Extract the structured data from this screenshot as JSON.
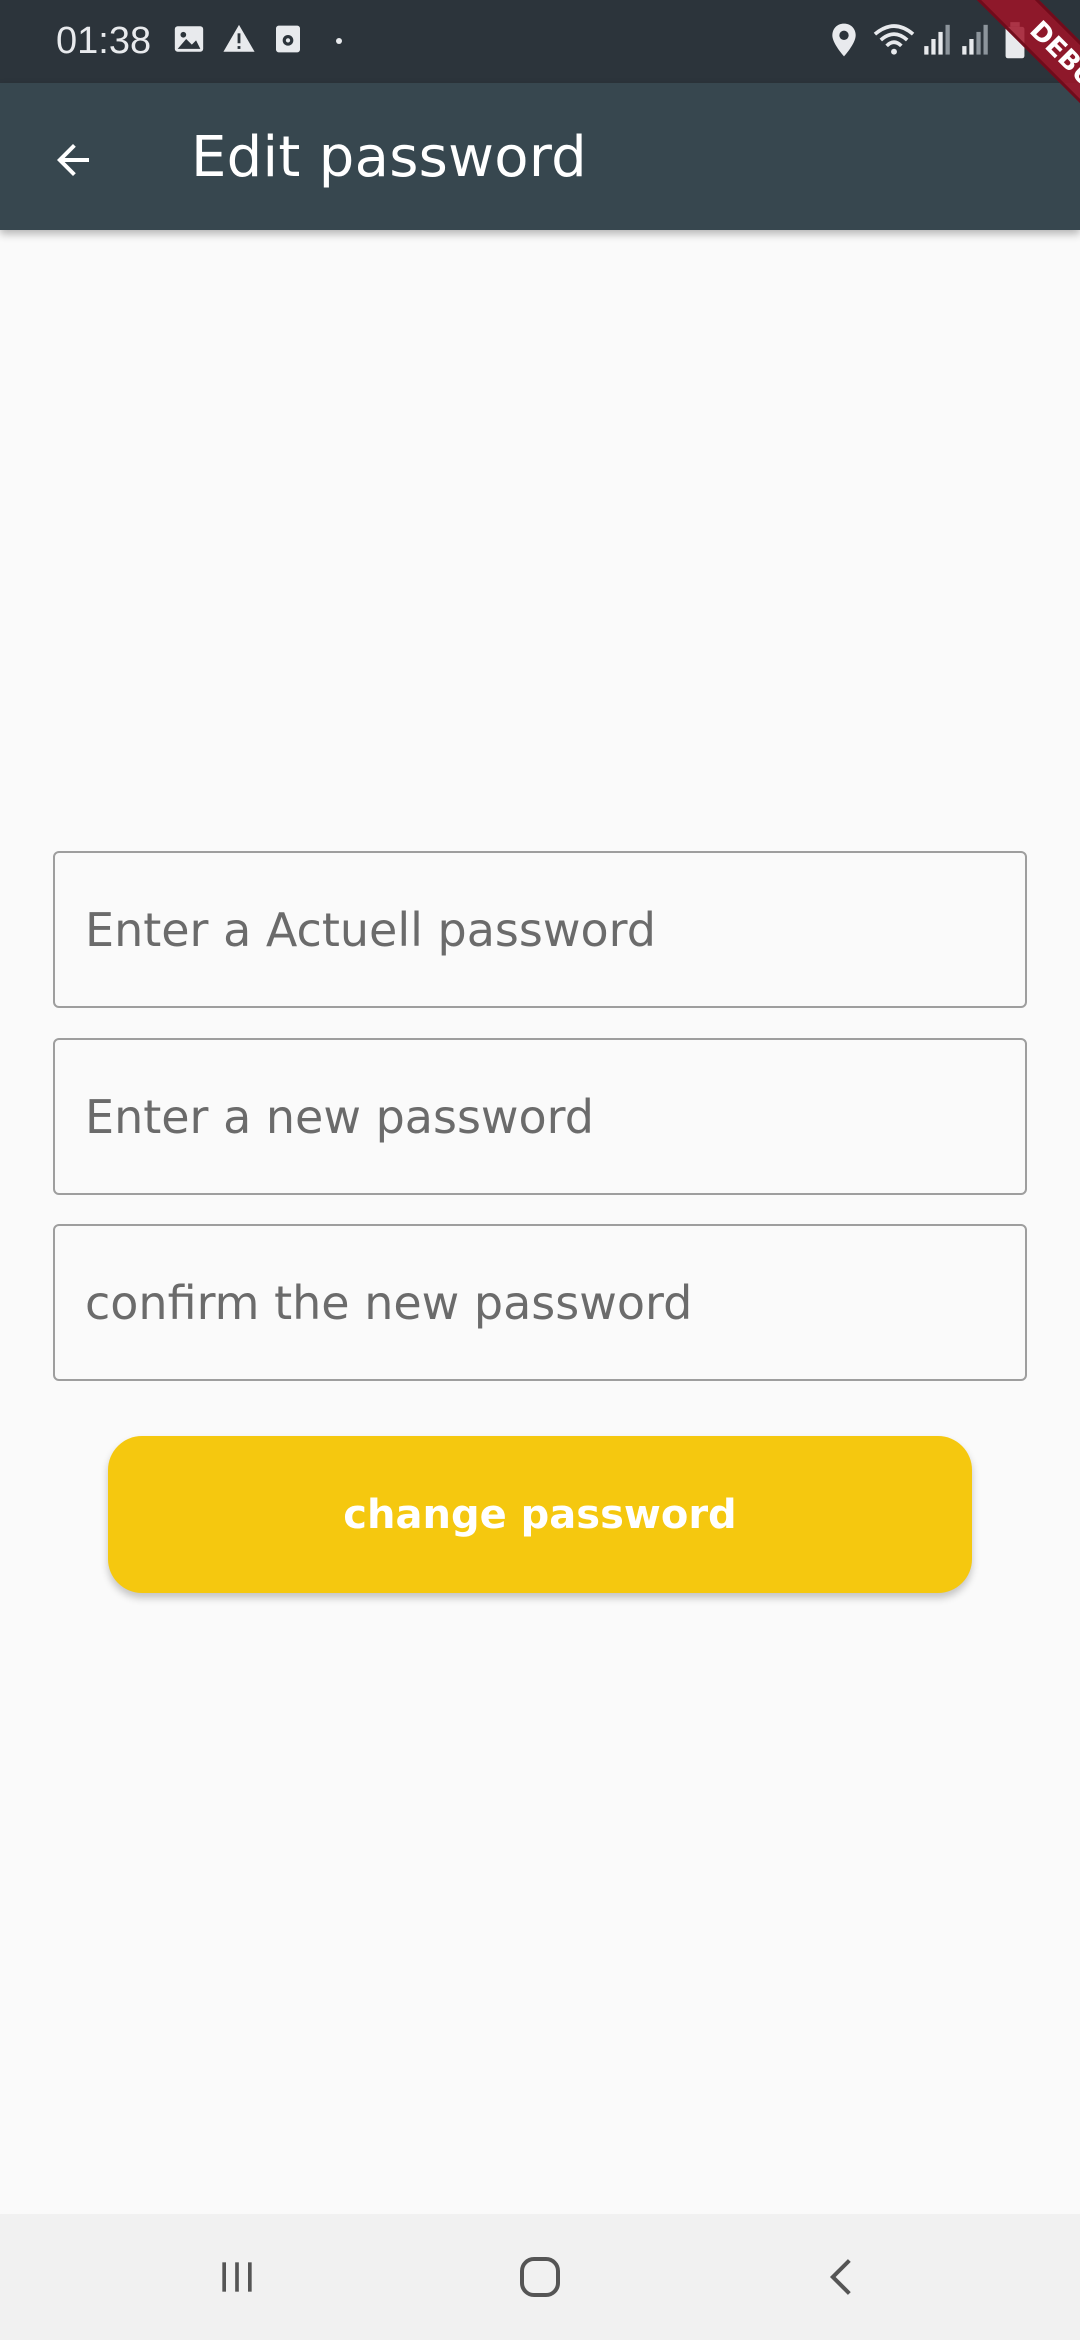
{
  "status_bar": {
    "time": "01:38",
    "left_icons": [
      "image-icon",
      "warning-icon",
      "record-icon",
      "dot-icon"
    ],
    "right_icons": [
      "location-icon",
      "wifi-icon",
      "signal-icon",
      "signal-icon",
      "battery-icon"
    ]
  },
  "debug_banner": {
    "label": "DEBUG"
  },
  "app_bar": {
    "back_icon": "arrow-left-icon",
    "title": "Edit password",
    "background": "#37474f"
  },
  "form": {
    "current_password": {
      "placeholder": "Enter a Actuell password",
      "value": ""
    },
    "new_password": {
      "placeholder": "Enter a new password",
      "value": ""
    },
    "confirm_password": {
      "placeholder": "confirm the new password",
      "value": ""
    },
    "submit_label": "change password",
    "accent": "#f5c80f"
  },
  "nav_bar": {
    "buttons": [
      "recents-icon",
      "home-icon",
      "back-icon"
    ]
  }
}
